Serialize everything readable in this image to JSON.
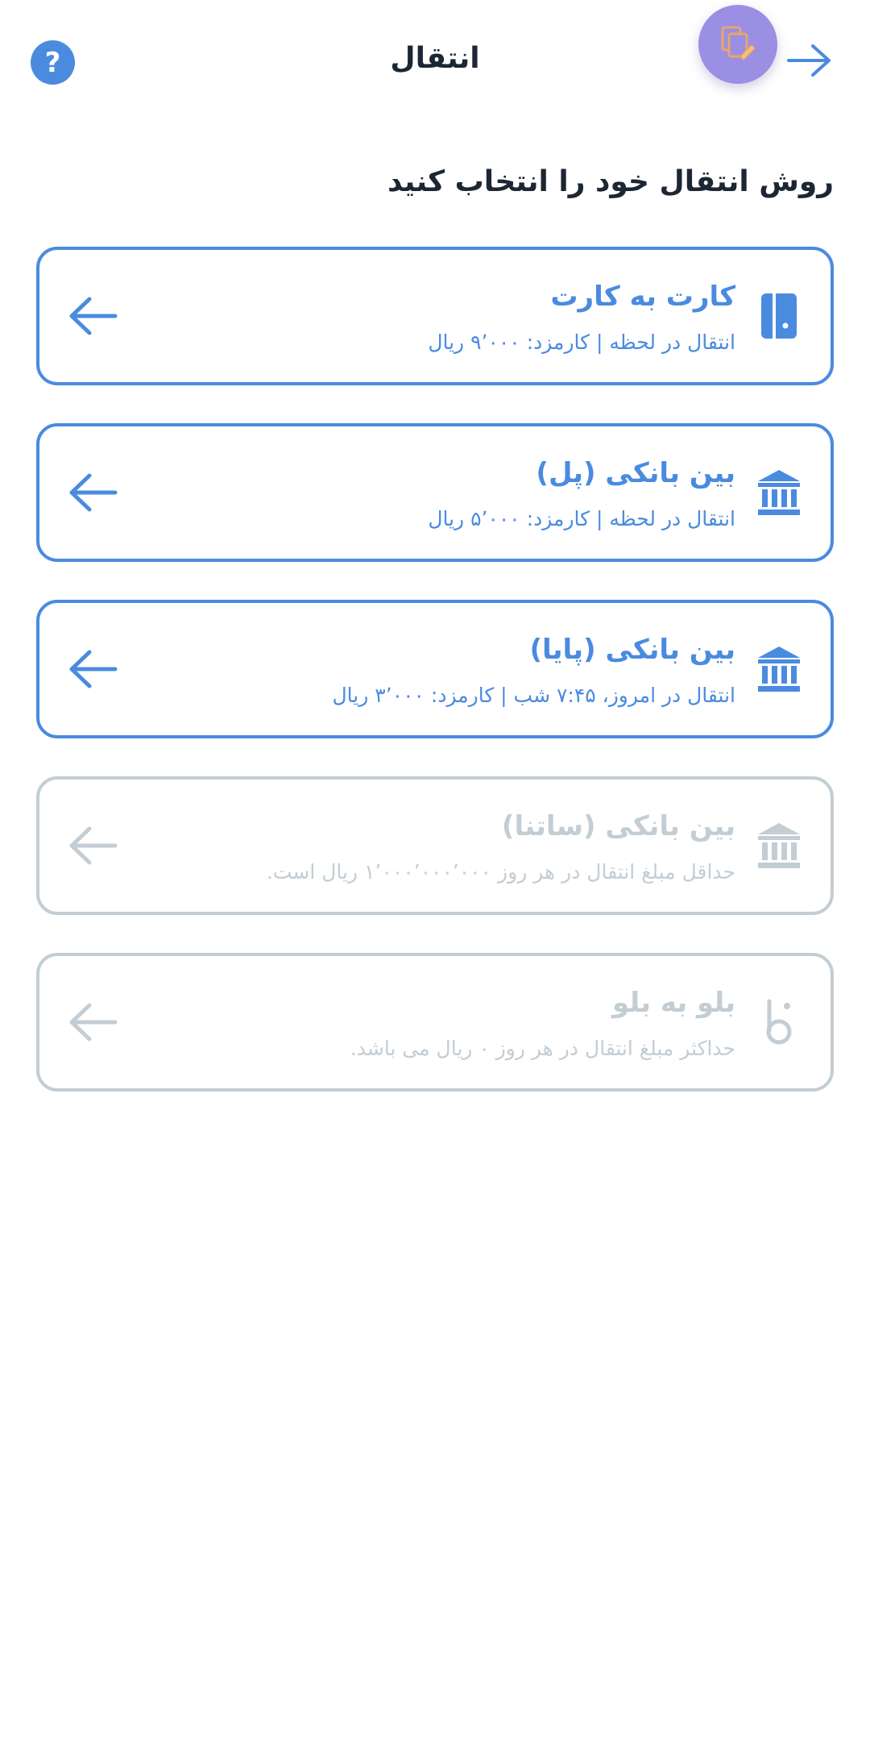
{
  "header": {
    "title": "انتقال",
    "help_label": "?"
  },
  "main": {
    "heading": "روش انتقال خود را انتخاب کنید",
    "options": [
      {
        "title": "کارت به کارت",
        "description": "انتقال در لحظه | کارمزد: ۹٬۰۰۰ ریال",
        "icon": "card-icon",
        "enabled": true
      },
      {
        "title": "بین بانکی (پل)",
        "description": "انتقال در لحظه | کارمزد: ۵٬۰۰۰ ریال",
        "icon": "bank-icon",
        "enabled": true
      },
      {
        "title": "بین بانکی (پایا)",
        "description": "انتقال در امروز، ۷:۴۵ شب | کارمزد: ۳٬۰۰۰ ریال",
        "icon": "bank-icon",
        "enabled": true
      },
      {
        "title": "بین بانکی (ساتنا)",
        "description": "حداقل مبلغ انتقال در هر روز ۱٬۰۰۰٬۰۰۰٬۰۰۰ ریال است.",
        "icon": "bank-icon",
        "enabled": false
      },
      {
        "title": "بلو به بلو",
        "description": "حداکثر مبلغ انتقال در هر روز ۰ ریال می باشد.",
        "icon": "blu-logo-icon",
        "enabled": false
      }
    ]
  },
  "colors": {
    "accent": "#4a8be0",
    "disabled": "#c3cdd4",
    "fab": "#9a8fe3",
    "text": "#1c2733"
  }
}
